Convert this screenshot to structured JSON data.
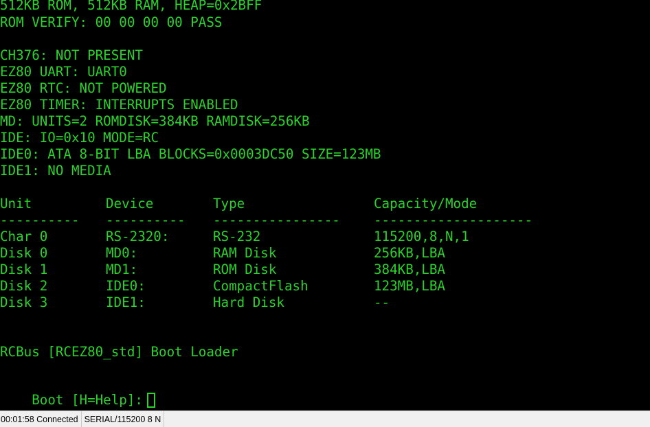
{
  "terminal": {
    "lines": [
      "512KB ROM, 512KB RAM, HEAP=0x2BFF",
      "ROM VERIFY: 00 00 00 00 PASS",
      "",
      "CH376: NOT PRESENT",
      "EZ80 UART: UART0",
      "EZ80 RTC: NOT POWERED",
      "EZ80 TIMER: INTERRUPTS ENABLED",
      "MD: UNITS=2 ROMDISK=384KB RAMDISK=256KB",
      "IDE: IO=0x10 MODE=RC",
      "IDE0: ATA 8-BIT LBA BLOCKS=0x0003DC50 SIZE=123MB",
      "IDE1: NO MEDIA"
    ],
    "table": {
      "headers": [
        "Unit",
        "Device",
        "Type",
        "Capacity/Mode"
      ],
      "separators": [
        "----------",
        "----------",
        "----------------",
        "--------------------"
      ],
      "rows": [
        [
          "Char 0",
          "RS-2320:",
          "RS-232",
          "115200,8,N,1"
        ],
        [
          "Disk 0",
          "MD0:",
          "RAM Disk",
          "256KB,LBA"
        ],
        [
          "Disk 1",
          "MD1:",
          "ROM Disk",
          "384KB,LBA"
        ],
        [
          "Disk 2",
          "IDE0:",
          "CompactFlash",
          "123MB,LBA"
        ],
        [
          "Disk 3",
          "IDE1:",
          "Hard Disk",
          "--"
        ]
      ]
    },
    "loader_title": "RCBus [RCEZ80_std] Boot Loader",
    "prompt": "Boot [H=Help]:",
    "text_color": "#2bd22b",
    "background": "#000000"
  },
  "statusbar": {
    "connection": "00:01:58 Connected",
    "port": "SERIAL/115200 8 N"
  }
}
